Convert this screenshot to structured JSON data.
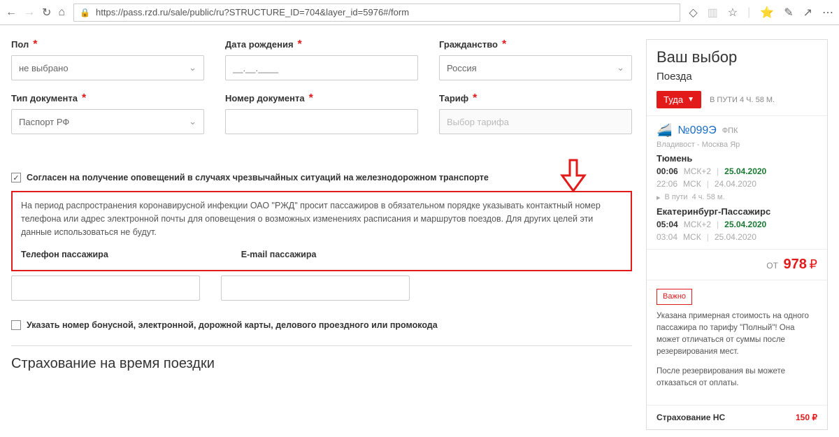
{
  "browser": {
    "url": "https://pass.rzd.ru/sale/public/ru?STRUCTURE_ID=704&layer_id=5976#/form"
  },
  "form": {
    "gender": {
      "label": "Пол",
      "value": "не выбрано"
    },
    "dob": {
      "label": "Дата рождения",
      "placeholder": "__.__.____"
    },
    "citizenship": {
      "label": "Гражданство",
      "value": "Россия"
    },
    "doc_type": {
      "label": "Тип документа",
      "value": "Паспорт РФ"
    },
    "doc_number": {
      "label": "Номер документа"
    },
    "tariff": {
      "label": "Тариф",
      "placeholder": "Выбор тарифа"
    },
    "consent": "Согласен на получение оповещений в случаях чрезвычайных ситуаций на железнодорожном транспорте",
    "notice": "На период распространения коронавирусной инфекции ОАО \"РЖД\" просит пассажиров в обязательном порядке указывать контактный номер телефона или адрес электронной почты для оповещения о возможных изменениях расписания и маршрутов поездов. Для других целей эти данные использоваться не будут.",
    "phone_label": "Телефон пассажира",
    "email_label": "E-mail пассажира",
    "bonus": "Указать номер бонусной, электронной, дорожной карты, делового проездного или промокода",
    "insurance_section": "Страхование на время поездки"
  },
  "sidebar": {
    "title": "Ваш выбор",
    "subtitle": "Поезда",
    "tab": "Туда",
    "transit": "В ПУТИ 4 Ч. 58 М.",
    "train": {
      "number": "№099Э",
      "company": "ФПК",
      "route": "Владивост - Москва Яр"
    },
    "dep": {
      "city": "Тюмень",
      "time": "00:06",
      "tz": "МСК+2",
      "date": "25.04.2020",
      "time2": "22:06",
      "tz2": "МСК",
      "date2": "24.04.2020"
    },
    "dur": {
      "label": "В пути",
      "value": "4 ч. 58 м."
    },
    "arr": {
      "city": "Екатеринбург-Пассажирс",
      "time": "05:04",
      "tz": "МСК+2",
      "date": "25.04.2020",
      "time2": "03:04",
      "tz2": "МСК",
      "date2": "25.04.2020"
    },
    "price": {
      "from": "ОТ",
      "amount": "978",
      "currency": "₽"
    },
    "important": {
      "badge": "Важно",
      "p1": "Указана примерная стоимость на одного пассажира по тарифу \"Полный\"! Она может отличаться от суммы после резервирования мест.",
      "p2": "После резервирования вы можете отказаться от оплаты."
    },
    "insurance": {
      "label": "Страхование НС",
      "amount": "150 ₽"
    }
  }
}
